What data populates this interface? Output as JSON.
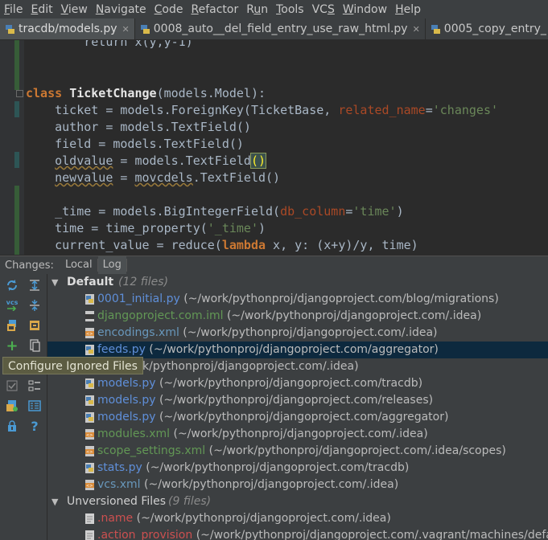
{
  "menu": [
    "File",
    "Edit",
    "View",
    "Navigate",
    "Code",
    "Refactor",
    "Run",
    "Tools",
    "VCS",
    "Window",
    "Help"
  ],
  "menu_mnemonic_index": [
    0,
    0,
    0,
    0,
    0,
    0,
    1,
    0,
    2,
    0,
    0
  ],
  "tabs": [
    {
      "label": "tracdb/models.py",
      "icon": "python-file-icon",
      "active": true
    },
    {
      "label": "0008_auto__del_field_entry_use_raw_html.py",
      "icon": "python-file-icon",
      "active": false
    },
    {
      "label": "0005_copy_entry_",
      "icon": "python-file-icon",
      "active": false
    }
  ],
  "code": {
    "line_partial": "        return x(y,y-1)",
    "class_kw": "class",
    "class_name": "TicketChange",
    "class_rest": "(models.Model):",
    "ticket": {
      "a": "    ticket = models.ForeignKey(TicketBase, ",
      "kwarg": "related_name",
      "eq": "=",
      "str": "'changes'"
    },
    "author": "    author = models.TextField()",
    "field": "    field = models.TextField()",
    "oldvalue": {
      "a": "    ",
      "name": "oldvalue",
      "b": " = models.TextField",
      "paren": "()"
    },
    "newvalue": {
      "a": "    ",
      "name": "newvalue",
      "b": " = ",
      "mod": "movcdels",
      "c": ".TextField()"
    },
    "time_field": {
      "a": "    _time = models.BigIntegerField(",
      "kwarg": "db_column",
      "eq": "=",
      "str": "'time'",
      "b": ")"
    },
    "time_prop": {
      "a": "    time = time_property(",
      "str": "'_time'",
      "b": ")"
    },
    "current": {
      "a": "    current_value = reduce(",
      "kw": "lambda",
      "b": " x, y: (x+y)/y, time)"
    }
  },
  "panel": {
    "title": "Changes:",
    "tabs": [
      "Local",
      "Log"
    ],
    "selected_tab": "Log"
  },
  "toolbar_icons": [
    "refresh-icon",
    "expand-all-icon",
    "vcs-icon",
    "collapse-all-icon",
    "shelve-icon",
    "group-by-icon",
    "add-icon",
    "copy-icon",
    "diff-icon",
    "configure-ignored-icon",
    "checkbox-icon",
    "ignored-files-icon",
    "lock-icon",
    "changelist-icon",
    "help-icon"
  ],
  "tooltip": "Configure Ignored Files",
  "tree": {
    "default_group": {
      "label": "Default",
      "count": "(12 files)"
    },
    "files": [
      {
        "name": "0001_initial.py",
        "path": "(~/work/pythonproj/djangoproject.com/blog/migrations)",
        "color": "bluel",
        "icon": "python"
      },
      {
        "name": "djangoproject.com.iml",
        "path": "(~/work/pythonproj/djangoproject.com/.idea)",
        "color": "green",
        "icon": "iml"
      },
      {
        "name": "encodings.xml",
        "path": "(~/work/pythonproj/djangoproject.com/.idea)",
        "color": "blue",
        "icon": "xml"
      },
      {
        "name": "feeds.py",
        "path": "(~/work/pythonproj/djangoproject.com/aggregator)",
        "color": "bluel",
        "icon": "python",
        "selected": true
      },
      {
        "name": "l",
        "path": "(~/work/pythonproj/djangoproject.com/.idea)",
        "color": "blue",
        "icon": "xml"
      },
      {
        "name": "models.py",
        "path": "(~/work/pythonproj/djangoproject.com/tracdb)",
        "color": "bluel",
        "icon": "python"
      },
      {
        "name": "models.py",
        "path": "(~/work/pythonproj/djangoproject.com/releases)",
        "color": "bluel",
        "icon": "python"
      },
      {
        "name": "models.py",
        "path": "(~/work/pythonproj/djangoproject.com/aggregator)",
        "color": "bluel",
        "icon": "python"
      },
      {
        "name": "modules.xml",
        "path": "(~/work/pythonproj/djangoproject.com/.idea)",
        "color": "green",
        "icon": "xml"
      },
      {
        "name": "scope_settings.xml",
        "path": "(~/work/pythonproj/djangoproject.com/.idea/scopes)",
        "color": "green",
        "icon": "xml"
      },
      {
        "name": "stats.py",
        "path": "(~/work/pythonproj/djangoproject.com/tracdb)",
        "color": "bluel",
        "icon": "python"
      },
      {
        "name": "vcs.xml",
        "path": "(~/work/pythonproj/djangoproject.com/.idea)",
        "color": "blue",
        "icon": "xml"
      }
    ],
    "unversioned_group": {
      "label": "Unversioned Files",
      "count": "(9 files)"
    },
    "unversioned": [
      {
        "name": ".name",
        "path": "(~/work/pythonproj/djangoproject.com/.idea)",
        "color": "red",
        "icon": "file"
      },
      {
        "name": ".action_provision",
        "path": "(~/work/pythonproj/djangoproject.com/.vagrant/machines/defau",
        "color": "red",
        "icon": "file"
      }
    ]
  }
}
